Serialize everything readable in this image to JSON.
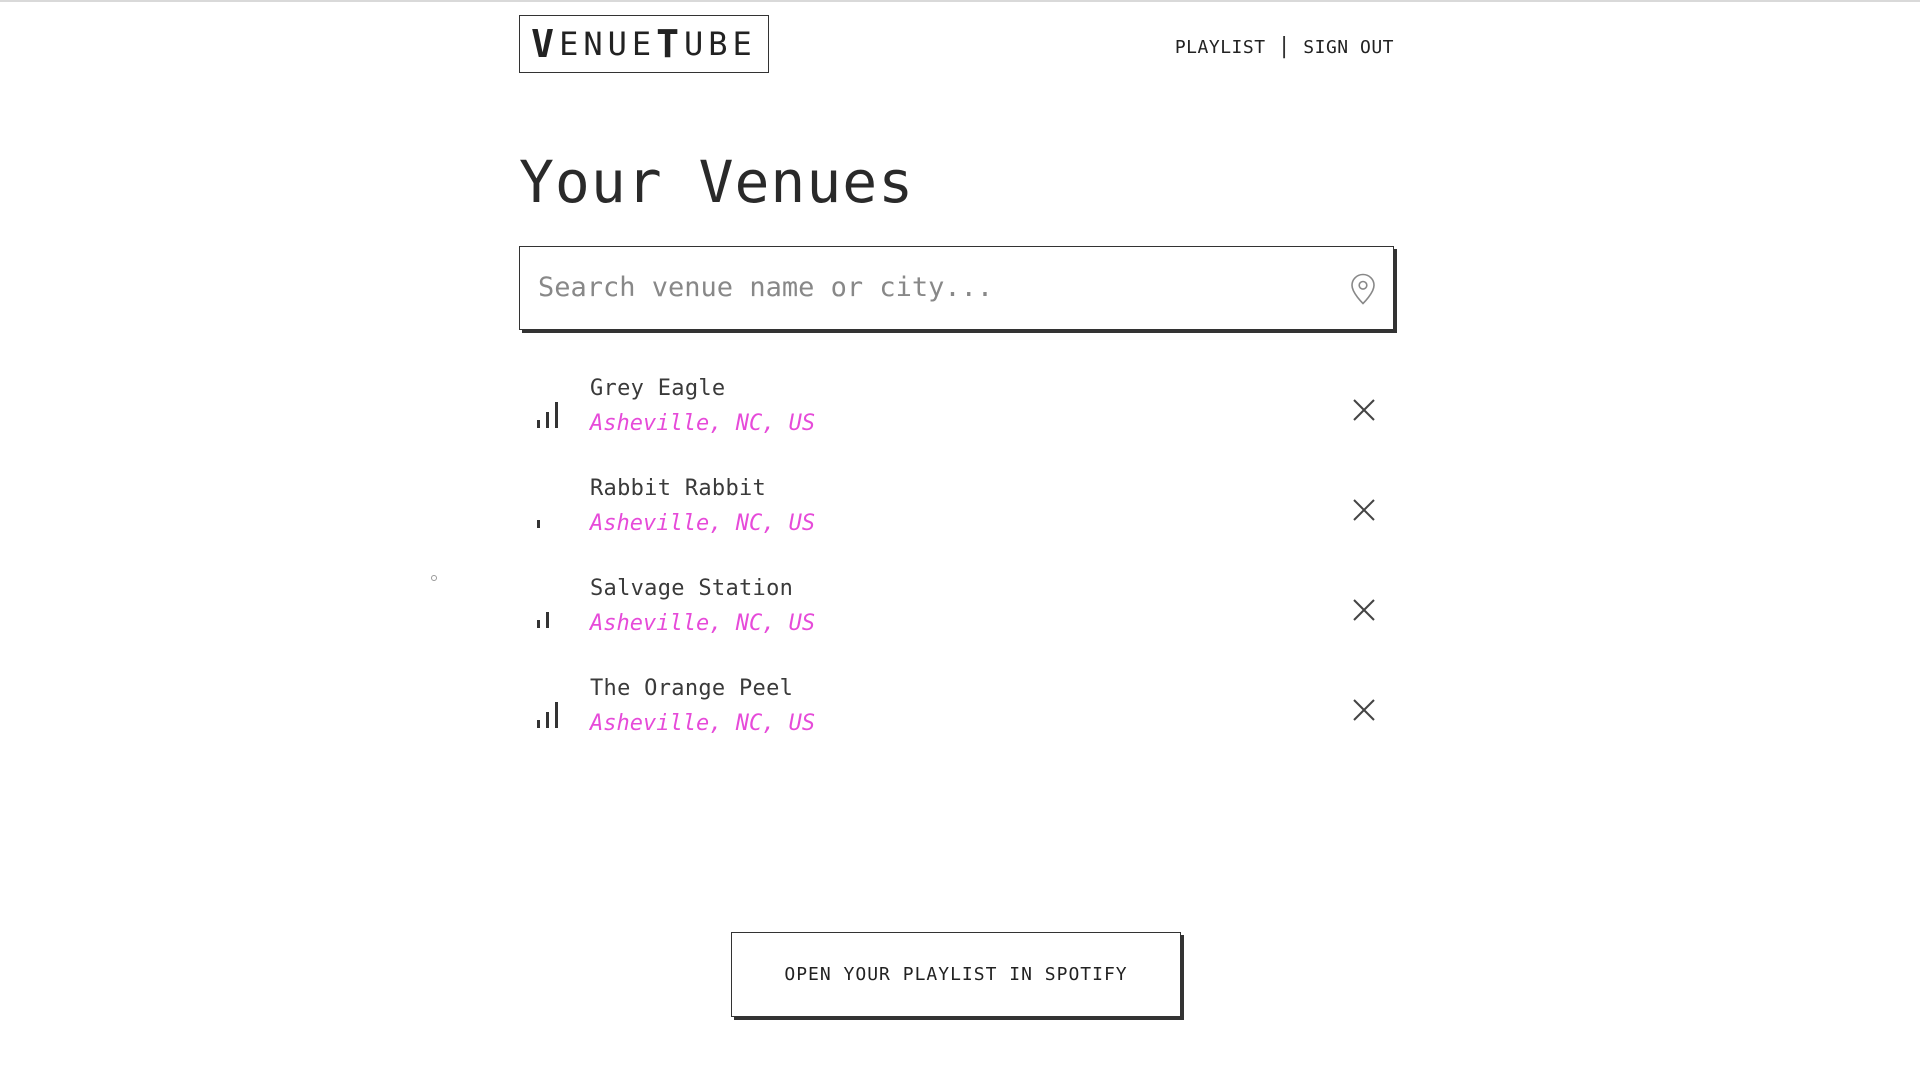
{
  "header": {
    "logo": {
      "part1_big": "V",
      "part1_rest": "ENUE",
      "part2_big": "T",
      "part2_rest": "UBE"
    },
    "nav": {
      "playlist": "PLAYLIST",
      "separator": "|",
      "sign_out": "SIGN OUT"
    }
  },
  "page_title": "Your Venues",
  "search": {
    "placeholder": "Search venue name or city...",
    "value": "",
    "icon": "map-pin-icon"
  },
  "venues": [
    {
      "name": "Grey Eagle",
      "location": "Asheville, NC, US",
      "signal_level": 3
    },
    {
      "name": "Rabbit Rabbit",
      "location": "Asheville, NC, US",
      "signal_level": 1
    },
    {
      "name": "Salvage Station",
      "location": "Asheville, NC, US",
      "signal_level": 2
    },
    {
      "name": "The Orange Peel",
      "location": "Asheville, NC, US",
      "signal_level": 3
    }
  ],
  "cta": {
    "label": "OPEN YOUR PLAYLIST IN SPOTIFY"
  },
  "colors": {
    "accent_location": "#e64bd9",
    "text": "#333333",
    "border": "#333333"
  }
}
